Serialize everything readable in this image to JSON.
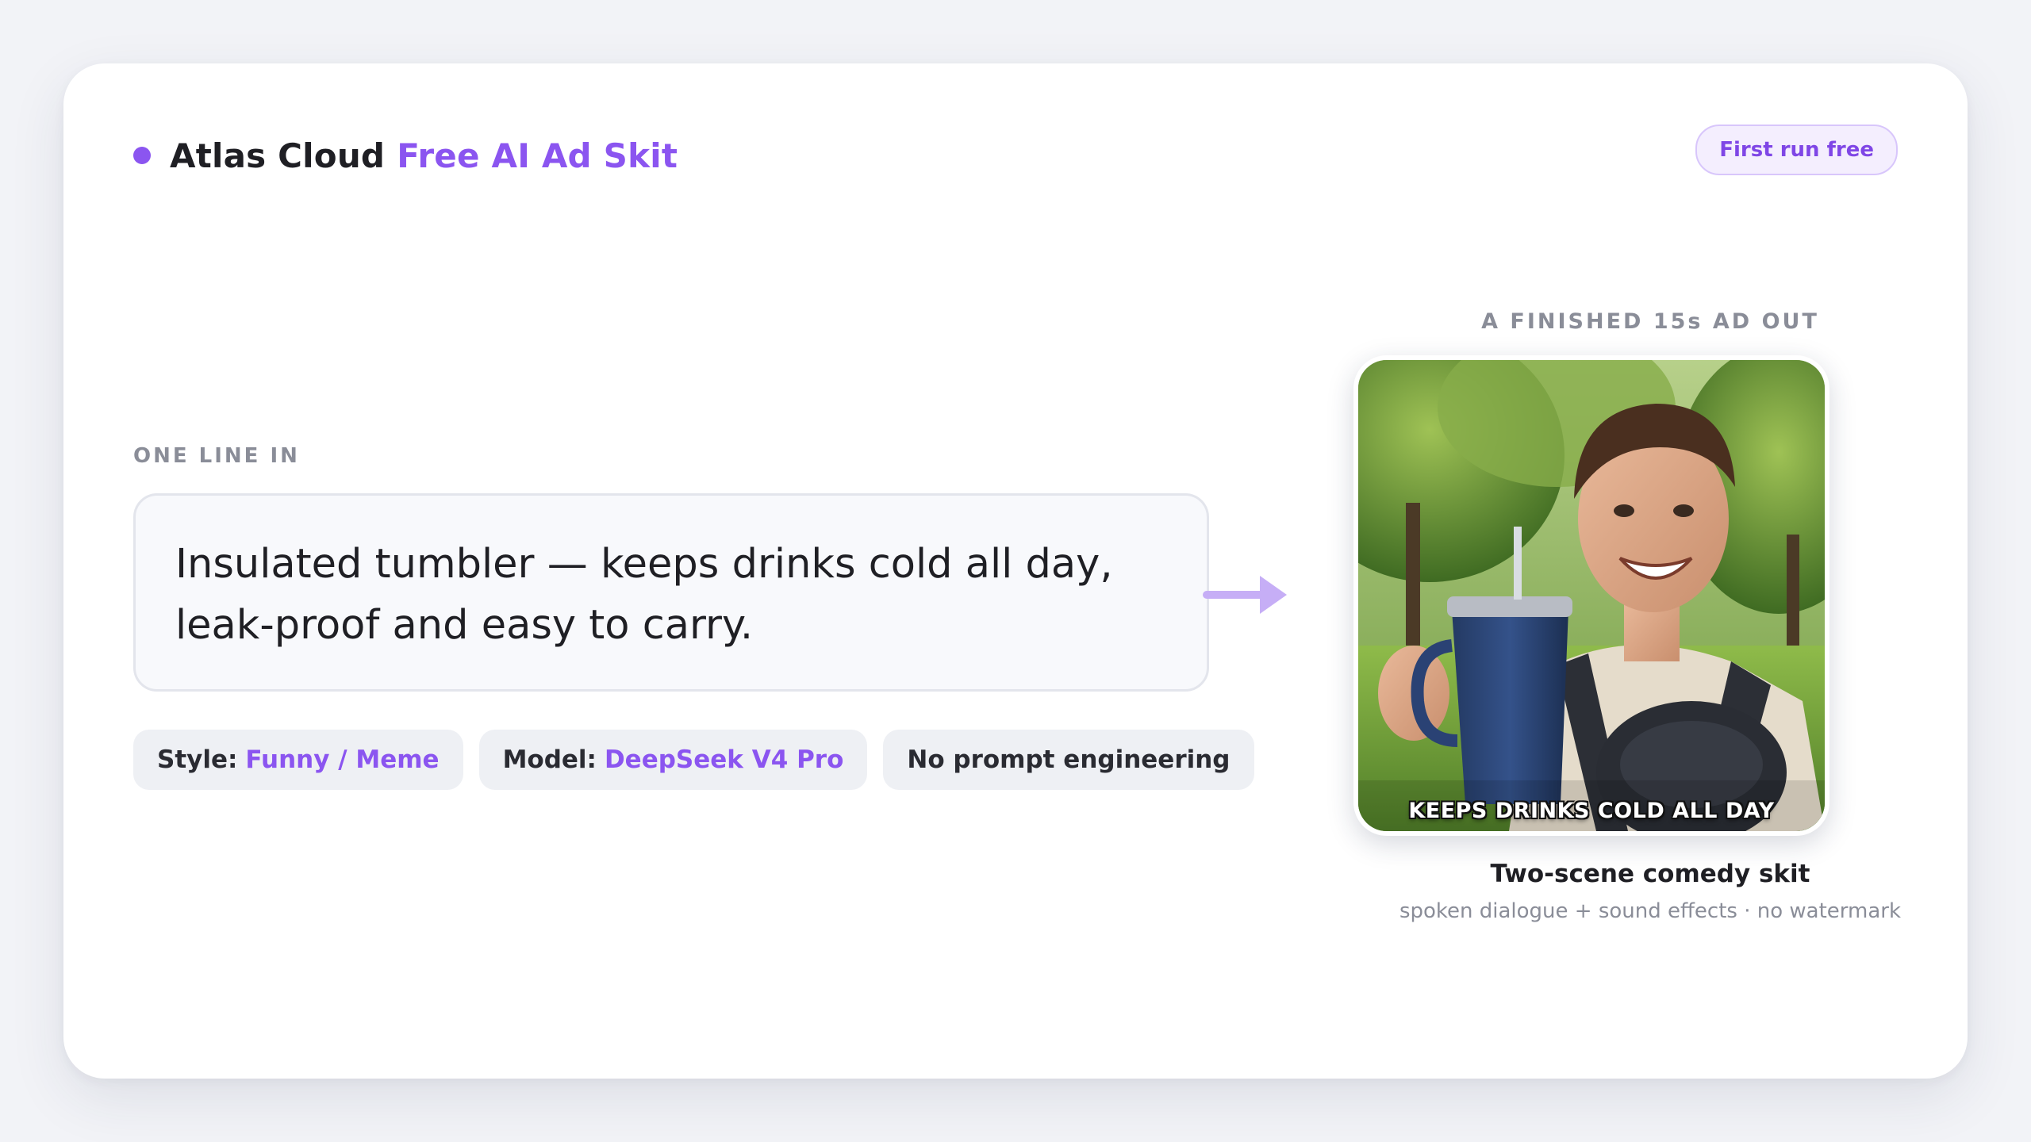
{
  "header": {
    "brand_name": "Atlas Cloud",
    "brand_accent": "Free AI Ad Skit",
    "badge": "First run free"
  },
  "input_section": {
    "label": "ONE LINE IN",
    "prompt_text": "Insulated tumbler — keeps drinks cold all day, leak-proof and easy to carry.",
    "chips": [
      {
        "key": "Style:",
        "value": "Funny / Meme"
      },
      {
        "key": "Model:",
        "value": "DeepSeek V4 Pro"
      },
      {
        "key": "No prompt engineering",
        "value": ""
      }
    ]
  },
  "output_section": {
    "label": "A FINISHED 15s AD OUT",
    "video_caption": "KEEPS DRINKS COLD ALL DAY",
    "title": "Two-scene comedy skit",
    "subtitle": "spoken dialogue + sound effects · no watermark"
  },
  "icons": {
    "status_dot": "status-dot-icon",
    "arrow": "arrow-right-icon"
  },
  "colors": {
    "accent": "#8b55f0",
    "badge_bg": "#f4eefe",
    "chip_bg": "#eef0f4",
    "muted_text": "#8a8d98",
    "arrow": "#c6aef6"
  }
}
